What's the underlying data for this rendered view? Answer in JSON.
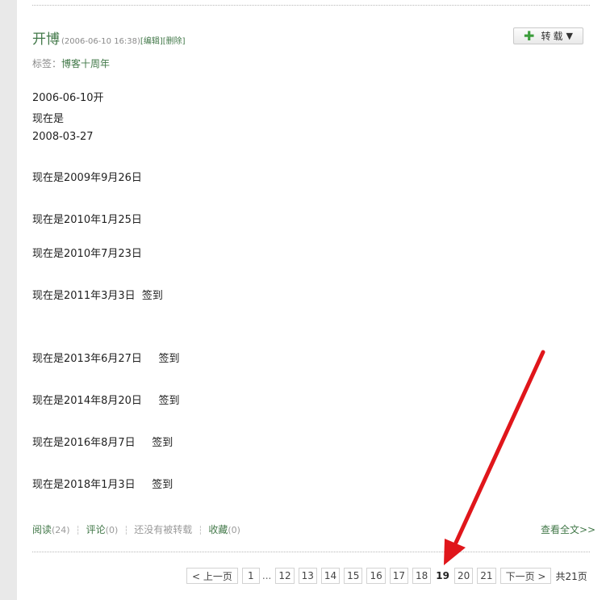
{
  "post": {
    "title": "开博",
    "meta_date": "(2006-06-10 16:38)",
    "edit_label": "[编辑]",
    "delete_label": "[删除]",
    "repost_label": "转载",
    "tags_label": "标签：",
    "tag": "博客十周年"
  },
  "lines": [
    "2006-06-10开",
    "现在是",
    "2008-03-27",
    "现在是2009年9月26日",
    "现在是2010年1月25日",
    "现在是2010年7月23日",
    "现在是2011年3月3日  签到",
    "现在是2013年6月27日     签到",
    "现在是2014年8月20日     签到",
    "现在是2016年8月7日     签到",
    "现在是2018年1月3日     签到"
  ],
  "footer": {
    "read_label": "阅读",
    "read_count": "(24)",
    "comment_label": "评论",
    "comment_count": "(0)",
    "not_reposted": "还没有被转载",
    "favorite_label": "收藏",
    "favorite_count": "(0)",
    "separator": "┆",
    "view_full": "查看全文>>"
  },
  "pager": {
    "prev": "< 上一页",
    "first": "1",
    "ellipsis": "...",
    "pages_before": [
      "12",
      "13",
      "14",
      "15",
      "16",
      "17",
      "18"
    ],
    "current": "19",
    "pages_after": [
      "20",
      "21"
    ],
    "next": "下一页 >",
    "total": "共21页"
  },
  "colors": {
    "link_green": "#43794a",
    "annotation_arrow": "#e0161b"
  }
}
